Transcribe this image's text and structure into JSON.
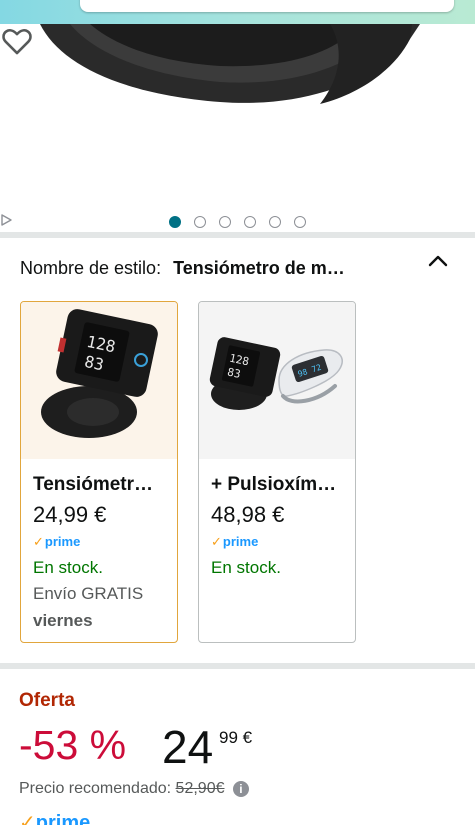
{
  "top": {
    "search_placeholder": ""
  },
  "gallery": {
    "wishlist_icon": "heart-outline-icon",
    "dots_count": 6,
    "active_dot": 0,
    "play_icon": "play-icon"
  },
  "style_selector": {
    "label": "Nombre de estilo:",
    "value": "Tensiómetro de m…"
  },
  "options": [
    {
      "title": "Tensiómetr…",
      "price": "24,99 €",
      "prime": "prime",
      "stock": "En stock.",
      "shipping": "Envío GRATIS",
      "day": "viernes",
      "selected": true
    },
    {
      "title": "+ Pulsioxím…",
      "price": "48,98 €",
      "prime": "prime",
      "stock": "En stock.",
      "selected": false
    }
  ],
  "offer": {
    "label": "Oferta",
    "discount": "-53 %",
    "price_whole": "24",
    "price_fraction": "99 €",
    "rrp_label": "Precio recomendado:",
    "rrp_value": "52,90€",
    "prime": "prime"
  },
  "colors": {
    "accent_teal": "#007185",
    "deal_red": "#cc0c39",
    "stock_green": "#007600",
    "prime_blue": "#1a98ff",
    "selected_border": "#e1a63d"
  }
}
